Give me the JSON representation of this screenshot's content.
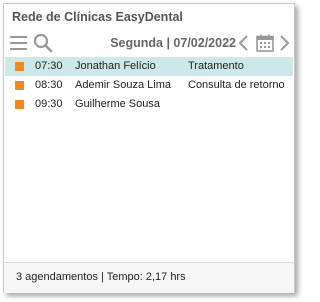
{
  "window": {
    "title": "Rede de Clínicas EasyDental"
  },
  "toolbar": {
    "menu_icon": "hamburger-menu-icon",
    "search_icon": "search-icon",
    "date_label": "Segunda | 07/02/2022",
    "prev_icon": "chevron-left-icon",
    "calendar_icon": "calendar-icon",
    "next_icon": "chevron-right-icon"
  },
  "appointments": [
    {
      "time": "07:30",
      "patient": "Jonathan Felício",
      "type": "Tratamento",
      "selected": true
    },
    {
      "time": "08:30",
      "patient": "Ademir Souza Lima",
      "type": "Consulta de retorno",
      "selected": false
    },
    {
      "time": "09:30",
      "patient": "Guilherme Sousa",
      "type": "",
      "selected": false
    }
  ],
  "footer": {
    "summary": "3 agendamentos | Tempo: 2,17 hrs"
  },
  "colors": {
    "marker": "#f08a1c",
    "selected_row": "#cde8e8",
    "icon": "#999999"
  }
}
